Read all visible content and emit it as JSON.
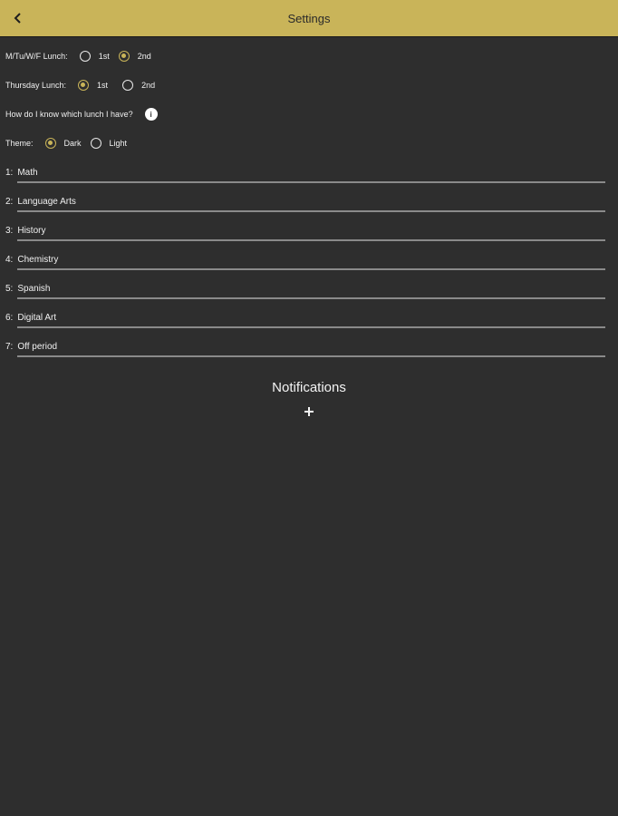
{
  "appbar": {
    "title": "Settings",
    "back_icon": "chevron-left-icon"
  },
  "colors": {
    "appbar": "#c9b459",
    "background": "#2e2e2e",
    "accent": "#c9b459"
  },
  "lunch_mtwf": {
    "label": "M/Tu/W/F Lunch:",
    "options": [
      "1st",
      "2nd"
    ],
    "selected": "2nd"
  },
  "lunch_thursday": {
    "label": "Thursday Lunch:",
    "options": [
      "1st",
      "2nd"
    ],
    "selected": "1st"
  },
  "lunch_help": {
    "label": "How do I know which lunch I have?",
    "icon": "info-icon",
    "icon_text": "i"
  },
  "theme": {
    "label": "Theme:",
    "options": [
      "Dark",
      "Light"
    ],
    "selected": "Dark"
  },
  "periods": [
    {
      "num": "1:",
      "name": "Math"
    },
    {
      "num": "2:",
      "name": "Language Arts"
    },
    {
      "num": "3:",
      "name": "History"
    },
    {
      "num": "4:",
      "name": "Chemistry"
    },
    {
      "num": "5:",
      "name": "Spanish"
    },
    {
      "num": "6:",
      "name": "Digital Art"
    },
    {
      "num": "7:",
      "name": "Off period"
    }
  ],
  "notifications": {
    "title": "Notifications",
    "add_icon": "plus-icon"
  }
}
